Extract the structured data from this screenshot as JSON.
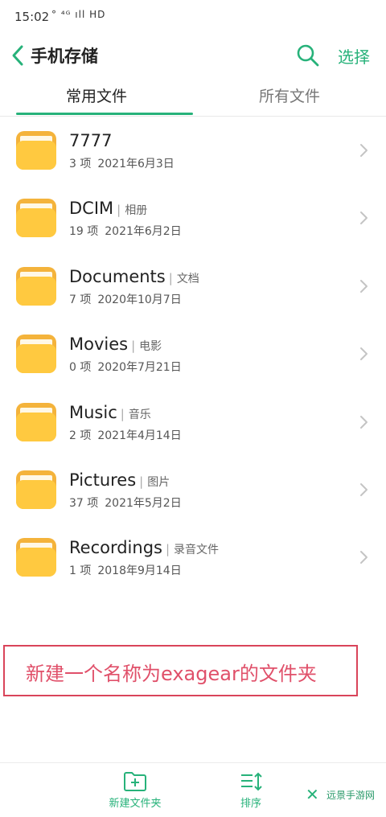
{
  "status_bar": {
    "time": "15:02",
    "indicators": "° ⁴ᴳ ıll HD"
  },
  "header": {
    "title": "手机存储",
    "select_label": "选择"
  },
  "tabs": [
    {
      "label": "常用文件",
      "active": true
    },
    {
      "label": "所有文件",
      "active": false
    }
  ],
  "folders": [
    {
      "name": "7777",
      "subtitle": "",
      "count": "3 项",
      "date": "2021年6月3日"
    },
    {
      "name": "DCIM",
      "subtitle": "相册",
      "count": "19 项",
      "date": "2021年6月2日"
    },
    {
      "name": "Documents",
      "subtitle": "文档",
      "count": "7 项",
      "date": "2020年10月7日"
    },
    {
      "name": "Movies",
      "subtitle": "电影",
      "count": "0 项",
      "date": "2020年7月21日"
    },
    {
      "name": "Music",
      "subtitle": "音乐",
      "count": "2 项",
      "date": "2021年4月14日"
    },
    {
      "name": "Pictures",
      "subtitle": "图片",
      "count": "37 项",
      "date": "2021年5月2日"
    },
    {
      "name": "Recordings",
      "subtitle": "录音文件",
      "count": "1 项",
      "date": "2018年9月14日"
    }
  ],
  "annotation": {
    "text": "新建一个名称为exagear的文件夹"
  },
  "bottom_bar": {
    "new_folder_label": "新建文件夹",
    "sort_label": "排序"
  },
  "watermark": {
    "text": "远景手游网"
  },
  "colors": {
    "accent": "#27b27a",
    "folder": "#ffc940",
    "annotation": "#e0506a"
  }
}
